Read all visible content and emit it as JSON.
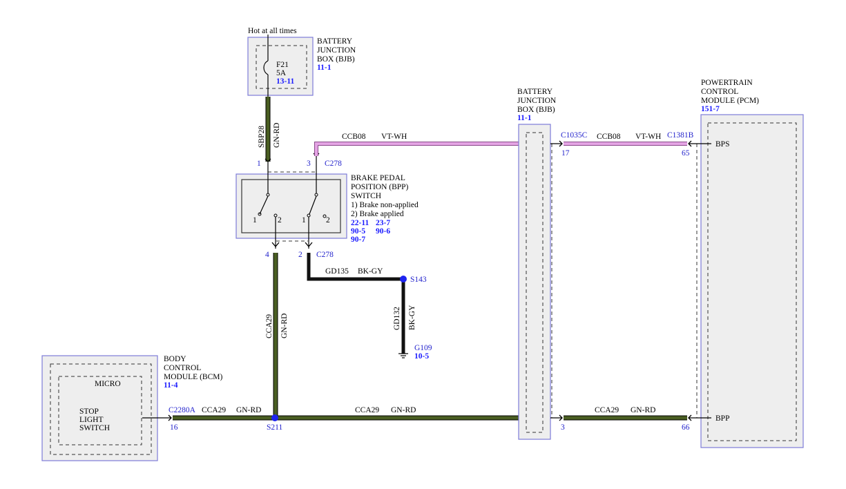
{
  "bjb_top": {
    "supply_note": "Hot at all times",
    "title": [
      "BATTERY",
      "JUNCTION",
      "BOX (BJB)"
    ],
    "ref": "11-1",
    "fuse_id": "F21",
    "fuse_rating": "5A",
    "fuse_ref": "13-11"
  },
  "bpp_switch": {
    "title": [
      "BRAKE PEDAL",
      "POSITION (BPP)",
      "SWITCH"
    ],
    "legend": [
      "1) Brake non-applied",
      "2) Brake applied"
    ],
    "refs": [
      "22-11",
      "23-7",
      "90-5",
      "90-6",
      "90-7"
    ],
    "pos_labels": [
      "1",
      "2",
      "1",
      "2"
    ]
  },
  "bjb_mid": {
    "title": [
      "BATTERY",
      "JUNCTION",
      "BOX (BJB)"
    ],
    "ref": "11-1"
  },
  "pcm": {
    "title": [
      "POWERTRAIN",
      "CONTROL",
      "MODULE (PCM)"
    ],
    "ref": "151-7",
    "pins": [
      "BPS",
      "BPP"
    ]
  },
  "bcm": {
    "title": [
      "BODY",
      "CONTROL",
      "MODULE (BCM)"
    ],
    "ref": "11-4",
    "inner_label": "MICRO",
    "function": [
      "STOP",
      "LIGHT",
      "SWITCH"
    ]
  },
  "ground": {
    "id": "G109",
    "ref": "10-5"
  },
  "circuits": {
    "sbp28": {
      "id": "SBP28",
      "color": "GN-RD"
    },
    "ccb08_left": {
      "id": "CCB08",
      "color": "VT-WH"
    },
    "ccb08_right": {
      "id": "CCB08",
      "color": "VT-WH"
    },
    "gd135": {
      "id": "GD135",
      "color": "BK-GY"
    },
    "gd132": {
      "id": "GD132",
      "color": "BK-GY"
    },
    "cca29_vertical": {
      "id": "CCA29",
      "color": "GN-RD"
    },
    "cca29_left": {
      "id": "CCA29",
      "color": "GN-RD"
    },
    "cca29_mid": {
      "id": "CCA29",
      "color": "GN-RD"
    },
    "cca29_right": {
      "id": "CCA29",
      "color": "GN-RD"
    }
  },
  "connectors": {
    "c278_top": {
      "name": "C278",
      "pins": [
        "1",
        "3"
      ]
    },
    "c278_bottom": {
      "name": "C278",
      "pins": [
        "4",
        "2"
      ]
    },
    "c1035c": {
      "name": "C1035C",
      "pins": [
        "17",
        "3"
      ]
    },
    "c1381b": {
      "name": "C1381B",
      "pins": [
        "65",
        "66"
      ]
    },
    "c2280a": {
      "name": "C2280A",
      "pin": "16"
    }
  },
  "splices": {
    "s143": "S143",
    "s211": "S211"
  },
  "colors": {
    "wire_green": "#4a5e22",
    "wire_violet": "#e4a4e4",
    "wire_black": "#111111",
    "component_outline": "#7d7bd8",
    "reference_blue": "#1a1aff",
    "splice_dot": "#1e24f0"
  }
}
